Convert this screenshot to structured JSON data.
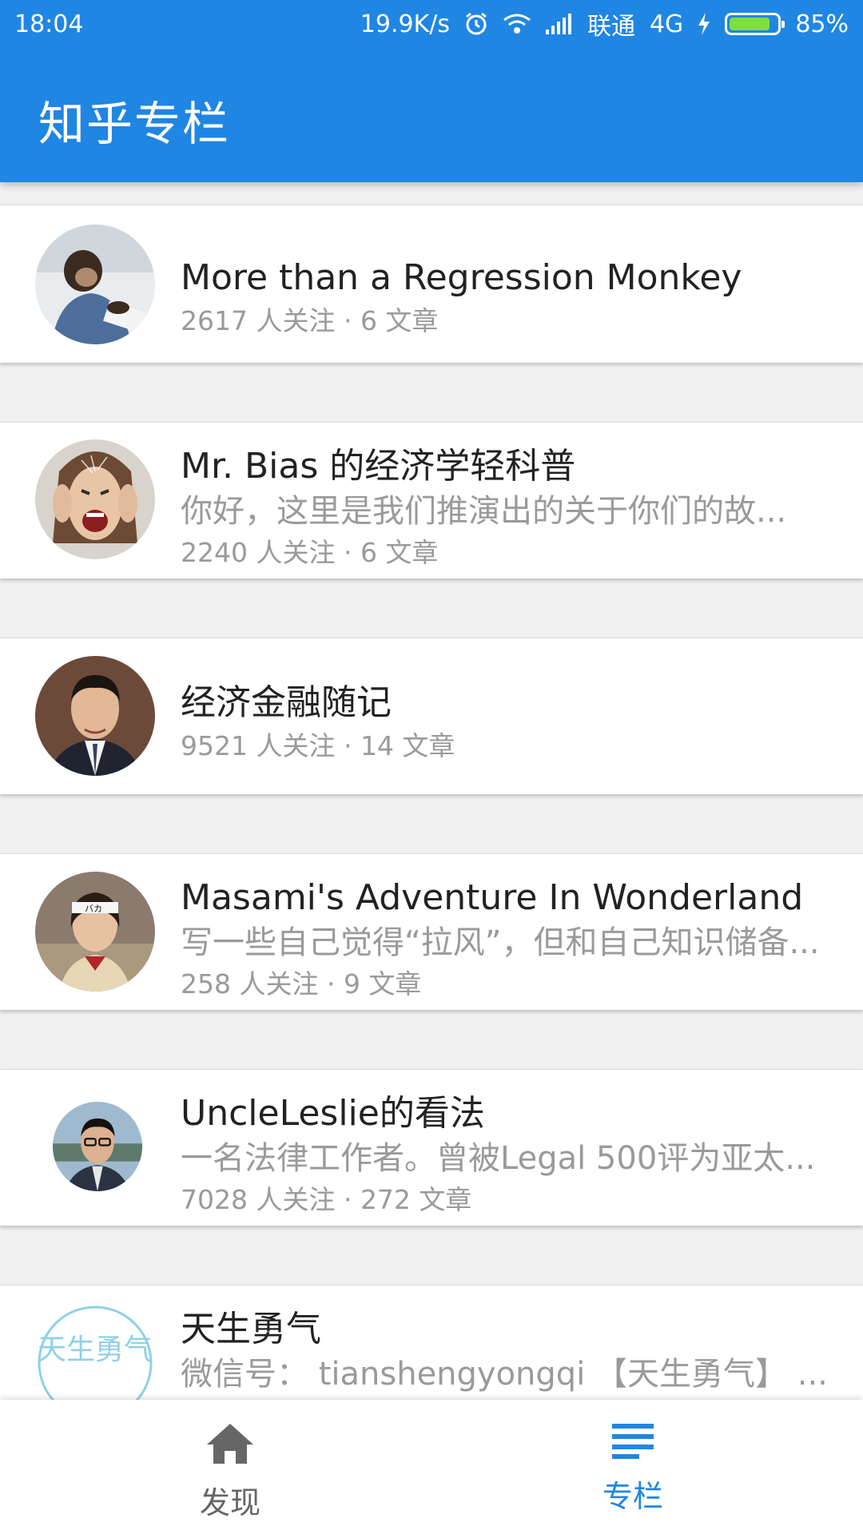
{
  "status_bar": {
    "time": "18:04",
    "network_speed": "19.9K/s",
    "carrier": "联通",
    "network_type": "4G",
    "battery_percent": "85%",
    "battery_level": 0.85,
    "icons": [
      "alarm-icon",
      "wifi-icon",
      "signal-icon",
      "charging-icon",
      "battery-icon"
    ]
  },
  "app_bar": {
    "title": "知乎专栏"
  },
  "colors": {
    "primary": "#2086e3",
    "secondary_text": "#9a9a9a",
    "battery_fill": "#7ee03a"
  },
  "columns": [
    {
      "title": "More than a Regression Monkey",
      "description": "",
      "meta": "2617 人关注 · 6 文章",
      "avatar": "monkey-avatar"
    },
    {
      "title": "Mr. Bias 的经济学轻科普",
      "description": "你好，这里是我们推演出的关于你们的故...",
      "meta": "2240 人关注 · 6 文章",
      "avatar": "screaming-woman-avatar"
    },
    {
      "title": "经济金融随记",
      "description": "",
      "meta": "9521 人关注 · 14 文章",
      "avatar": "man-in-suit-avatar"
    },
    {
      "title": "Masami's Adventure In Wonderland",
      "description": "写一些自己觉得“拉风”，但和自己知识储备...",
      "meta": "258 人关注 · 9 文章",
      "avatar": "girl-headband-avatar"
    },
    {
      "title": "UncleLeslie的看法",
      "description": "一名法律工作者。曾被Legal 500评为亚太...",
      "meta": "7028 人关注 · 272 文章",
      "avatar": "man-glasses-avatar"
    },
    {
      "title": "天生勇气",
      "description": "微信号： tianshengyongqi 【天生勇气】 ...",
      "meta": "",
      "avatar": "tiansheng-logo-avatar",
      "avatar_text": "天生勇气"
    }
  ],
  "bottom_nav": {
    "items": [
      {
        "label": "发现",
        "icon": "home-icon",
        "selected": false
      },
      {
        "label": "专栏",
        "icon": "list-icon",
        "selected": true
      }
    ]
  }
}
